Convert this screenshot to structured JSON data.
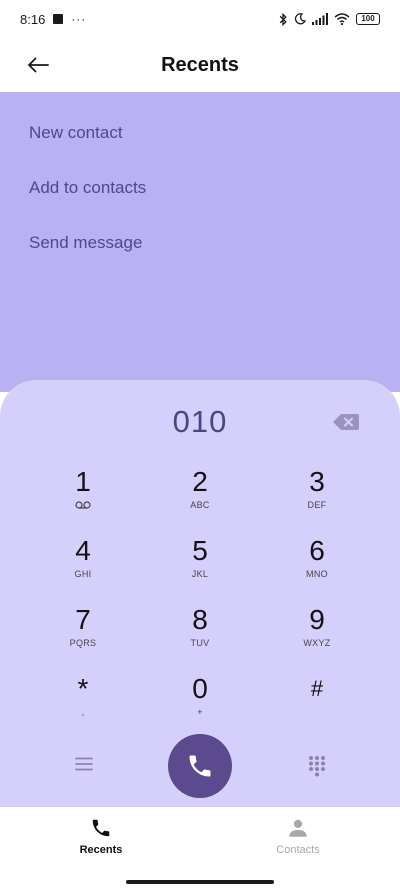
{
  "status_bar": {
    "time": "8:16",
    "dots": "···",
    "battery": "100"
  },
  "header": {
    "title": "Recents",
    "back_icon": "arrow-left-icon"
  },
  "options": {
    "items": [
      {
        "label": "New contact"
      },
      {
        "label": "Add to contacts"
      },
      {
        "label": "Send message"
      }
    ]
  },
  "dialpad": {
    "number": "010",
    "backspace_icon": "backspace-icon",
    "keys": [
      {
        "digit": "1",
        "letters": "",
        "sub_icon": "voicemail-icon"
      },
      {
        "digit": "2",
        "letters": "ABC"
      },
      {
        "digit": "3",
        "letters": "DEF"
      },
      {
        "digit": "4",
        "letters": "GHI"
      },
      {
        "digit": "5",
        "letters": "JKL"
      },
      {
        "digit": "6",
        "letters": "MNO"
      },
      {
        "digit": "7",
        "letters": "PQRS"
      },
      {
        "digit": "8",
        "letters": "TUV"
      },
      {
        "digit": "9",
        "letters": "WXYZ"
      },
      {
        "digit": "*",
        "letters": ","
      },
      {
        "digit": "0",
        "letters": "+"
      },
      {
        "digit": "#",
        "letters": ""
      }
    ],
    "call_icon": "phone-icon",
    "menu_icon": "menu-icon",
    "grid_icon": "dialpad-grid-icon"
  },
  "bottom_nav": {
    "items": [
      {
        "label": "Recents",
        "icon": "phone-icon",
        "active": true
      },
      {
        "label": "Contacts",
        "icon": "person-icon",
        "active": false
      }
    ]
  },
  "colors": {
    "options_bg": "#b9b1f1",
    "dialpad_bg": "#d5cffc",
    "call_button": "#5b4a8e",
    "accent_text": "#4f478f"
  }
}
